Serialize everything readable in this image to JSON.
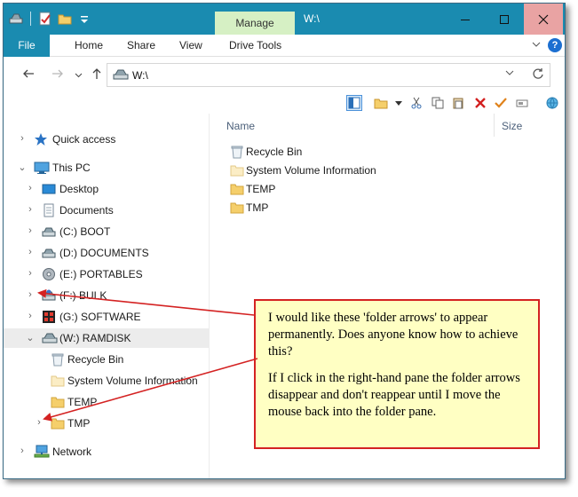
{
  "window": {
    "title": "W:\\",
    "contextual_tab": "Manage"
  },
  "ribbon": {
    "tabs": [
      "File",
      "Home",
      "Share",
      "View",
      "Drive Tools"
    ]
  },
  "address": {
    "path": "W:\\"
  },
  "nav_tree": [
    {
      "label": "Quick access",
      "icon": "star-icon",
      "expanded": false
    },
    {
      "label": "This PC",
      "icon": "computer-icon",
      "expanded": true
    },
    {
      "label": "Desktop",
      "icon": "desktop-icon",
      "expanded": false
    },
    {
      "label": "Documents",
      "icon": "documents-icon",
      "expanded": false
    },
    {
      "label": "(C:) BOOT",
      "icon": "drive-icon",
      "expanded": false
    },
    {
      "label": "(D:) DOCUMENTS",
      "icon": "drive-icon",
      "expanded": false
    },
    {
      "label": "(E:) PORTABLES",
      "icon": "disc-icon",
      "expanded": false
    },
    {
      "label": "(F:) BULK",
      "icon": "drive-icon",
      "expanded": false
    },
    {
      "label": "(G:) SOFTWARE",
      "icon": "grid-drive-icon",
      "expanded": false
    },
    {
      "label": "(W:) RAMDISK",
      "icon": "drive-icon",
      "expanded": true
    },
    {
      "label": "Recycle Bin",
      "icon": "recycle-bin-icon",
      "expanded": null
    },
    {
      "label": "System Volume Information",
      "icon": "folder-icon",
      "expanded": null
    },
    {
      "label": "TEMP",
      "icon": "folder-icon",
      "expanded": null
    },
    {
      "label": "TMP",
      "icon": "folder-icon",
      "expanded": false
    },
    {
      "label": "Network",
      "icon": "network-icon",
      "expanded": false
    }
  ],
  "file_list": {
    "columns": [
      "Name",
      "Size"
    ],
    "items": [
      {
        "name": "Recycle Bin",
        "icon": "recycle-bin-icon"
      },
      {
        "name": "System Volume Information",
        "icon": "folder-icon"
      },
      {
        "name": "TEMP",
        "icon": "folder-icon"
      },
      {
        "name": "TMP",
        "icon": "folder-icon"
      }
    ]
  },
  "callout": {
    "paragraph1": "I would like these 'folder arrows' to appear permanently. Does anyone know how to achieve this?",
    "paragraph2": "If I click in the right-hand pane the folder arrows disappear and don't reappear until I move the mouse back into the folder pane."
  },
  "colors": {
    "titlebar": "#1a8bb0",
    "manage_tab": "#d6f0c4",
    "callout_bg": "#ffffc3",
    "callout_border": "#d42222",
    "arrow": "#d42222"
  }
}
